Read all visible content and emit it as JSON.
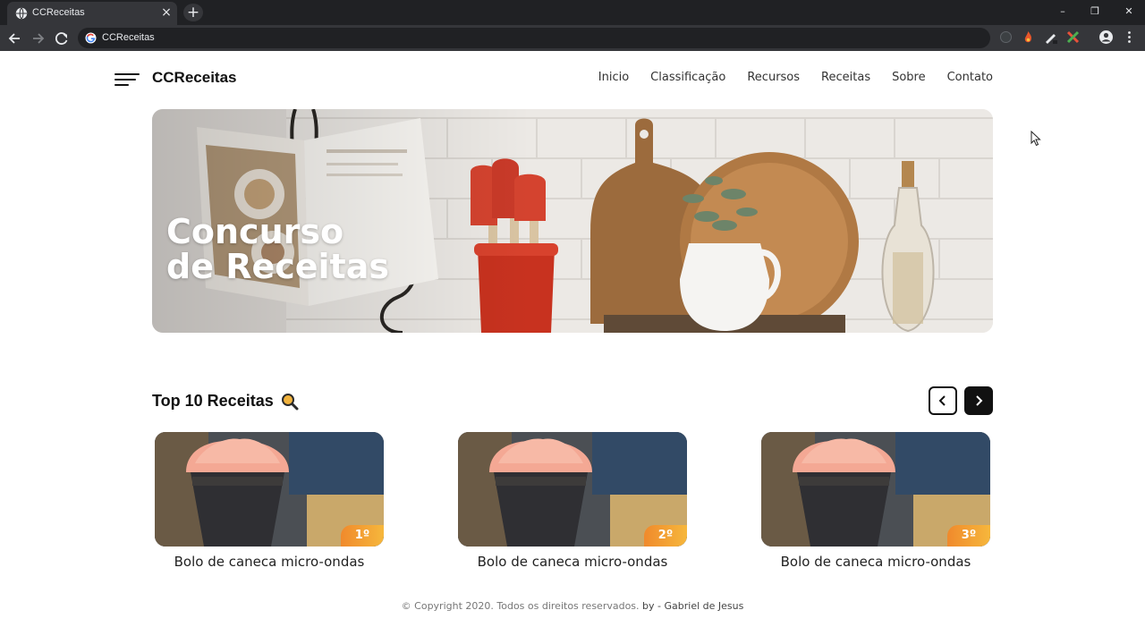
{
  "browser": {
    "tab_title": "CCReceitas",
    "new_tab_label": "+",
    "tab_close_label": "×",
    "address": "CCReceitas",
    "window_controls": [
      "–",
      "❐",
      "✕"
    ]
  },
  "header": {
    "brand": "CCReceitas",
    "nav": [
      "Inicio",
      "Classificação",
      "Recursos",
      "Receitas",
      "Sobre",
      "Contato"
    ]
  },
  "hero": {
    "title": "Concurso de Receitas"
  },
  "top10": {
    "title": "Top 10 Receitas",
    "icon": "magnifier-icon",
    "cards": [
      {
        "title": "Bolo de caneca micro-ondas",
        "rank": "1º"
      },
      {
        "title": "Bolo de caneca micro-ondas",
        "rank": "2º"
      },
      {
        "title": "Bolo de caneca micro-ondas",
        "rank": "3º"
      }
    ]
  },
  "footer": {
    "copyright": "© Copyright 2020. Todos os direitos reservados.",
    "author": "by - Gabriel de Jesus"
  },
  "colors": {
    "chrome_dark": "#202124",
    "chrome_tab": "#35363a",
    "rank_orange": "#f08a2c",
    "rank_yellow": "#f6b73c"
  }
}
